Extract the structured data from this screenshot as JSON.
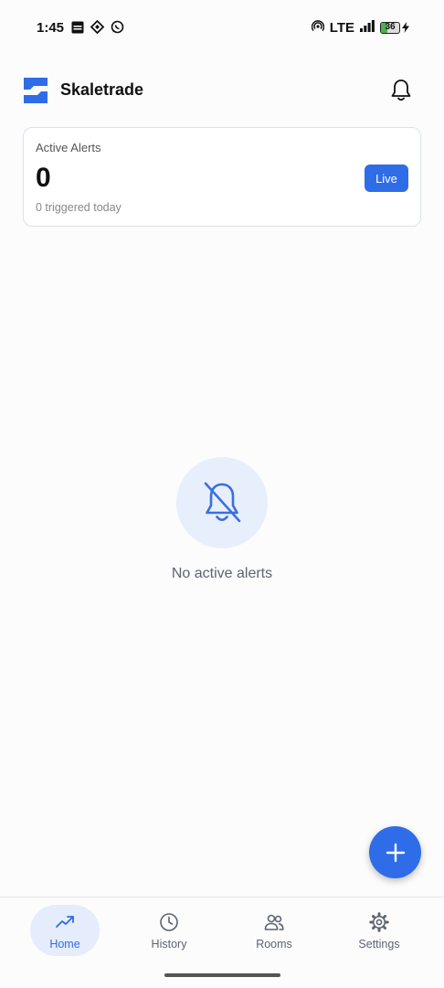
{
  "status_bar": {
    "time": "1:45",
    "network": "LTE",
    "battery_level": "36",
    "battery_fraction": 0.36,
    "left_icons": [
      "news-icon",
      "gps-icon",
      "whatsapp-icon"
    ],
    "right_icons": [
      "hotspot-icon",
      "signal-icon",
      "battery-icon",
      "charging-icon"
    ]
  },
  "header": {
    "title": "Skaletrade",
    "logo_icon": "skaletrade-logo",
    "notifications_icon": "bell-icon"
  },
  "alerts_card": {
    "label": "Active Alerts",
    "count": "0",
    "subtext": "0 triggered today",
    "badge": "Live"
  },
  "empty_state": {
    "icon": "bell-off-icon",
    "message": "No active alerts"
  },
  "fab": {
    "icon": "plus-icon"
  },
  "bottom_nav": {
    "items": [
      {
        "label": "Home",
        "icon": "trending-up-icon",
        "active": true
      },
      {
        "label": "History",
        "icon": "clock-icon",
        "active": false
      },
      {
        "label": "Rooms",
        "icon": "users-icon",
        "active": false
      },
      {
        "label": "Settings",
        "icon": "gear-icon",
        "active": false
      }
    ]
  },
  "colors": {
    "accent": "#2f6ce8",
    "accent_light": "#e5ecfb",
    "muted_text": "#5d6470",
    "card_border": "#d9e3ec"
  }
}
